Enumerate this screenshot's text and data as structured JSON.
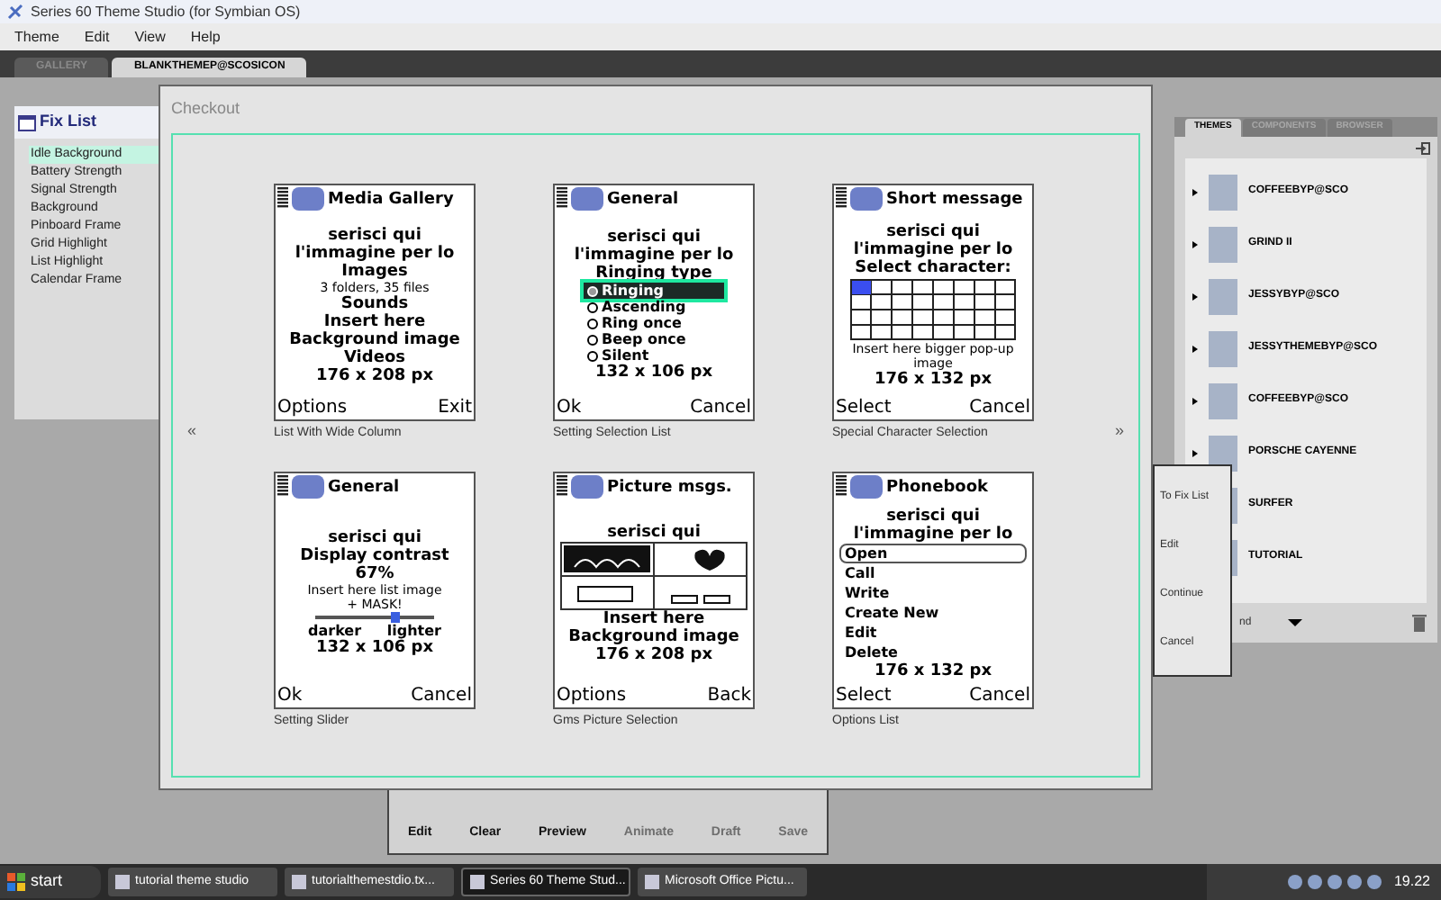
{
  "window": {
    "title": "Series 60 Theme Studio (for Symbian OS)"
  },
  "menu": [
    "Theme",
    "Edit",
    "View",
    "Help"
  ],
  "doc_tabs": [
    {
      "label": "GALLERY",
      "selected": false
    },
    {
      "label": "BLANKTHEMEP@SCOSICON",
      "selected": true
    }
  ],
  "fix_list": {
    "title": "Fix List",
    "items": [
      {
        "label": "Idle Background",
        "selected": true
      },
      {
        "label": "Battery Strength",
        "selected": false
      },
      {
        "label": "Signal Strength",
        "selected": false
      },
      {
        "label": "Background",
        "selected": false
      },
      {
        "label": "Pinboard Frame",
        "selected": false
      },
      {
        "label": "Grid Highlight",
        "selected": false
      },
      {
        "label": "List Highlight",
        "selected": false
      },
      {
        "label": "Calendar Frame",
        "selected": false
      }
    ]
  },
  "checkout": {
    "title": "Checkout",
    "prev": "«",
    "next": "»",
    "phones": [
      {
        "title": "Media Gallery",
        "caption": "List With Wide Column",
        "softkeys": [
          "Options",
          "Exit"
        ],
        "items": [
          {
            "kind": "bold",
            "text": "serisci qui"
          },
          {
            "kind": "bold",
            "text": "l'immagine per lo"
          },
          {
            "kind": "bold",
            "text": "Images"
          },
          {
            "kind": "small",
            "text": "3 folders, 35 files"
          },
          {
            "kind": "bold",
            "text": "Sounds"
          },
          {
            "kind": "bold",
            "text": "Insert here"
          },
          {
            "kind": "bold",
            "text": "Background image"
          },
          {
            "kind": "bold",
            "text": "Videos"
          },
          {
            "kind": "bold",
            "text": "176 x 208 px"
          }
        ]
      },
      {
        "title": "General",
        "caption": "Setting Selection List",
        "softkeys": [
          "Ok",
          "Cancel"
        ],
        "items": [
          {
            "kind": "bold",
            "text": "serisci qui"
          },
          {
            "kind": "bold",
            "text": "l'immagine per lo"
          },
          {
            "kind": "bold",
            "text": "Ringing type"
          },
          {
            "kind": "radio",
            "text": "Ringing",
            "selected": true
          },
          {
            "kind": "radio",
            "text": "Ascending",
            "selected": false
          },
          {
            "kind": "radio",
            "text": "Ring once",
            "selected": false
          },
          {
            "kind": "radio",
            "text": "Beep once",
            "selected": false
          },
          {
            "kind": "radio",
            "text": "Silent",
            "selected": false
          },
          {
            "kind": "bold",
            "text": "132 x 106 px"
          }
        ]
      },
      {
        "title": "Short message",
        "caption": "Special Character Selection",
        "softkeys": [
          "Select",
          "Cancel"
        ],
        "items": [
          {
            "kind": "bold",
            "text": "serisci qui"
          },
          {
            "kind": "bold",
            "text": "l'immagine per lo"
          },
          {
            "kind": "bold",
            "text": "Select character:"
          },
          {
            "kind": "chargrid"
          },
          {
            "kind": "small",
            "text": "Insert here bigger pop-up image"
          },
          {
            "kind": "bold",
            "text": "176 x 132 px"
          }
        ]
      },
      {
        "title": "General",
        "caption": "Setting Slider",
        "softkeys": [
          "Ok",
          "Cancel"
        ],
        "items": [
          {
            "kind": "bold",
            "text": "serisci qui"
          },
          {
            "kind": "bold",
            "text": "Display contrast"
          },
          {
            "kind": "bold",
            "text": "67%"
          },
          {
            "kind": "small",
            "text": "Insert here list image"
          },
          {
            "kind": "small",
            "text": "+ MASK!"
          },
          {
            "kind": "slider",
            "level": 0.67
          },
          {
            "kind": "range",
            "text": "darker",
            "text2": "lighter"
          },
          {
            "kind": "bold",
            "text": "132 x 106 px"
          }
        ]
      },
      {
        "title": "Picture msgs.",
        "caption": "Gms Picture Selection",
        "softkeys": [
          "Options",
          "Back"
        ],
        "items": [
          {
            "kind": "bold",
            "text": "serisci qui"
          },
          {
            "kind": "picgrid"
          },
          {
            "kind": "bold",
            "text": "Insert here"
          },
          {
            "kind": "bold",
            "text": "Background image"
          },
          {
            "kind": "bold",
            "text": "176 x 208 px"
          }
        ]
      },
      {
        "title": "Phonebook",
        "caption": "Options List",
        "softkeys": [
          "Select",
          "Cancel"
        ],
        "items": [
          {
            "kind": "bold",
            "text": "serisci qui"
          },
          {
            "kind": "bold",
            "text": "l'immagine per lo"
          },
          {
            "kind": "menu",
            "text": "Open",
            "selected": true
          },
          {
            "kind": "menu",
            "text": "Call",
            "selected": false
          },
          {
            "kind": "menu",
            "text": "Write",
            "selected": false
          },
          {
            "kind": "menu",
            "text": "Create New",
            "selected": false
          },
          {
            "kind": "menu",
            "text": "Edit",
            "selected": false
          },
          {
            "kind": "menu",
            "text": "Delete",
            "selected": false
          },
          {
            "kind": "bold",
            "text": "176 x 132 px"
          }
        ]
      }
    ]
  },
  "toolbar": [
    {
      "label": "Edit",
      "disabled": false
    },
    {
      "label": "Clear",
      "disabled": false
    },
    {
      "label": "Preview",
      "disabled": false
    },
    {
      "label": "Animate",
      "disabled": true
    },
    {
      "label": "Draft",
      "disabled": true
    },
    {
      "label": "Save",
      "disabled": true
    }
  ],
  "themes_panel": {
    "tabs": [
      {
        "label": "THEMES",
        "selected": true
      },
      {
        "label": "COMPONENTS",
        "selected": false
      },
      {
        "label": "BROWSER",
        "selected": false
      }
    ],
    "items": [
      "COFFEEBYP@SCO",
      "GRIND II",
      "JESSYBYP@SCO",
      "JESSYTHEMEBYP@SCO",
      "COFFEEBYP@SCO",
      "PORSCHE CAYENNE",
      "SURFER",
      "TUTORIAL"
    ],
    "filter": "nd"
  },
  "context_menu": [
    "To Fix List",
    "Edit",
    "Continue",
    "Cancel"
  ],
  "taskbar": {
    "start": "start",
    "tasks": [
      {
        "label": "tutorial theme studio",
        "selected": false
      },
      {
        "label": "tutorialthemestdio.tx...",
        "selected": false
      },
      {
        "label": "Series 60 Theme Stud...",
        "selected": true
      },
      {
        "label": "Microsoft Office Pictu...",
        "selected": false
      }
    ],
    "clock": "19.22"
  }
}
